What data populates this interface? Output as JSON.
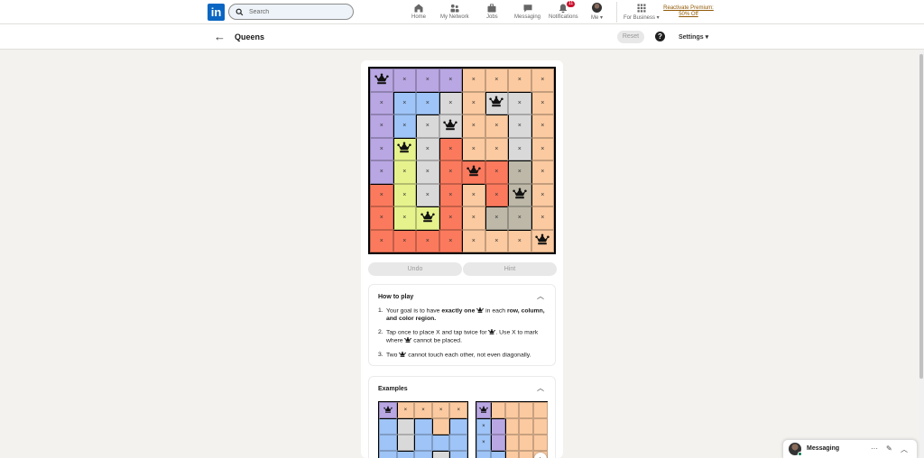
{
  "nav": {
    "search_placeholder": "Search",
    "items": [
      {
        "label": "Home",
        "icon": "home-icon"
      },
      {
        "label": "My Network",
        "icon": "network-icon"
      },
      {
        "label": "Jobs",
        "icon": "briefcase-icon"
      },
      {
        "label": "Messaging",
        "icon": "chat-icon"
      },
      {
        "label": "Notifications",
        "icon": "bell-icon",
        "badge": "11"
      },
      {
        "label": "Me",
        "icon": "avatar"
      }
    ],
    "for_business": "For Business",
    "premium": "Reactivate Premium: 50% Off"
  },
  "game": {
    "title": "Queens",
    "reset": "Reset",
    "settings": "Settings",
    "undo": "Undo",
    "hint": "Hint",
    "mark": "×",
    "board": {
      "regions": [
        "PPPPOOOO",
        "PBBGOGGO",
        "PBGGOOGO",
        "PYGROOGO",
        "PYGRRRTO",
        "RYGRORTO",
        "RYYROTTO",
        "RRRROOOO"
      ],
      "queens": [
        [
          0,
          0
        ],
        [
          1,
          5
        ],
        [
          2,
          3
        ],
        [
          3,
          1
        ],
        [
          4,
          4
        ],
        [
          5,
          6
        ],
        [
          6,
          2
        ],
        [
          7,
          7
        ]
      ],
      "colors": {
        "P": "#b9a7e3",
        "O": "#fbcaa0",
        "B": "#9fc4f7",
        "G": "#d9d9d9",
        "Y": "#e6f38d",
        "R": "#fb7a5d",
        "T": "#bdb8a8"
      }
    }
  },
  "howto": {
    "title": "How to play",
    "rules": [
      {
        "num": "1.",
        "pre": "Your goal is to have ",
        "bold": "exactly one",
        "mid": " in each ",
        "bold2": "row, column, and color region."
      },
      {
        "num": "2.",
        "pre": "Tap once to place X and tap twice for",
        "mid": ". Use X to mark where",
        "post": " cannot be placed."
      },
      {
        "num": "3.",
        "pre": "Two",
        "post": " cannot touch each other, not even diagonally."
      }
    ]
  },
  "examples": {
    "title": "Examples",
    "next": "›"
  },
  "messaging": {
    "label": "Messaging",
    "more": "···",
    "compose": "✎",
    "collapse": "︿"
  }
}
